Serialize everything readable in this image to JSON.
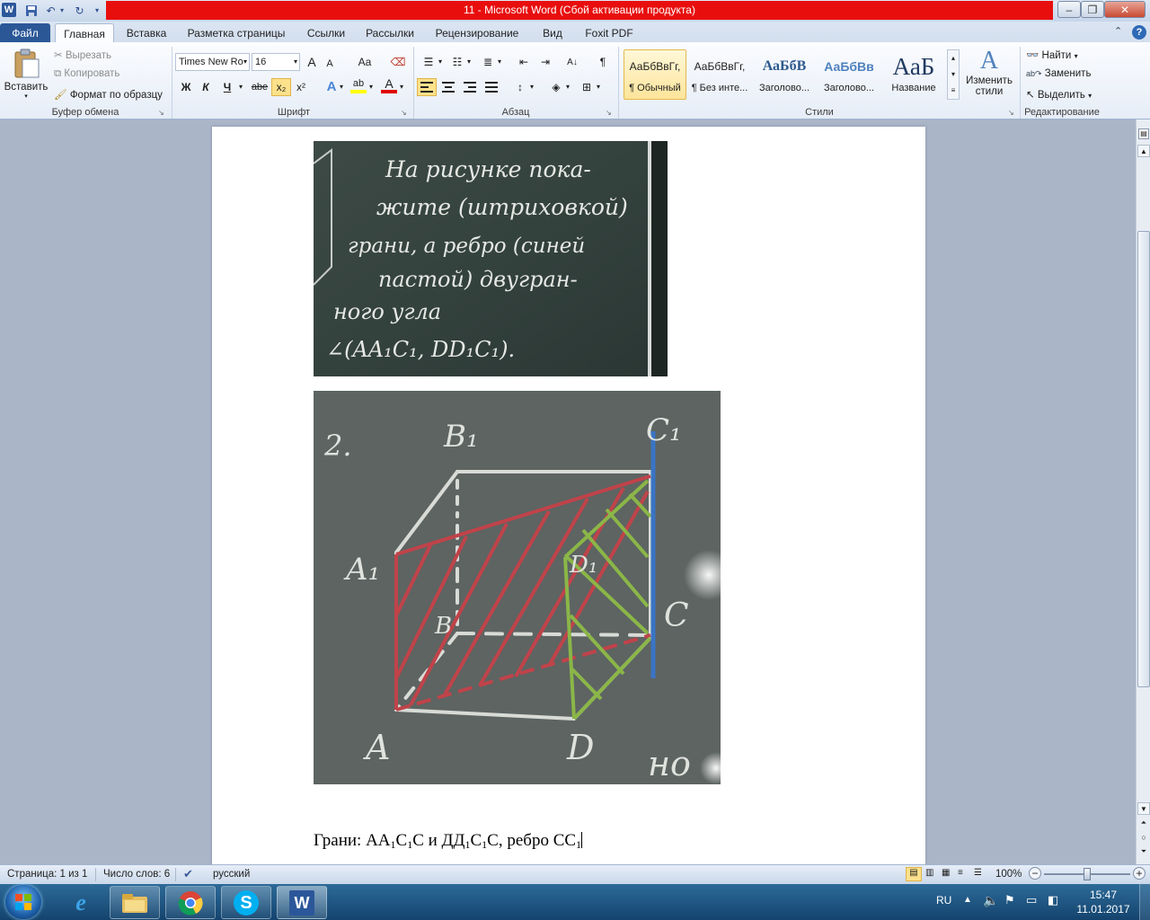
{
  "window": {
    "title": "11  -  Microsoft Word (Сбой активации продукта)",
    "app_icon": "W"
  },
  "tabs": [
    {
      "label": "Файл"
    },
    {
      "label": "Главная"
    },
    {
      "label": "Вставка"
    },
    {
      "label": "Разметка страницы"
    },
    {
      "label": "Ссылки"
    },
    {
      "label": "Рассылки"
    },
    {
      "label": "Рецензирование"
    },
    {
      "label": "Вид"
    },
    {
      "label": "Foxit PDF"
    }
  ],
  "clipboard": {
    "paste": "Вставить",
    "cut": "Вырезать",
    "copy": "Копировать",
    "format_painter": "Формат по образцу",
    "group": "Буфер обмена"
  },
  "font": {
    "name": "Times New Ro",
    "size": "16",
    "group": "Шрифт",
    "bold": "Ж",
    "italic": "К",
    "underline": "Ч",
    "strike": "abe",
    "subscript": "x₂",
    "superscript": "x²",
    "grow": "A",
    "shrink": "A",
    "change_case": "Aa",
    "font_color_letter": "A",
    "highlight_letter": "ab"
  },
  "paragraph": {
    "group": "Абзац"
  },
  "styles": {
    "group": "Стили",
    "items": [
      {
        "preview": "АаБбВвГг,",
        "name": "¶ Обычный"
      },
      {
        "preview": "АаБбВвГг,",
        "name": "¶ Без инте..."
      },
      {
        "preview": "АаБбВ",
        "name": "Заголово..."
      },
      {
        "preview": "АаБбВв",
        "name": "Заголово..."
      },
      {
        "preview": "АаБ",
        "name": "Название"
      }
    ],
    "change_styles": "Изменить стили"
  },
  "editing": {
    "group": "Редактирование",
    "find": "Найти",
    "replace": "Заменить",
    "select": "Выделить"
  },
  "document": {
    "image1_alt": "Доска с заданием",
    "image1_lines": [
      "На рисунке пока-",
      "жите (штриховкой)",
      "грани, а ребро (синей",
      "пастой) двугран-",
      "ного угла",
      "∠(AA₁C₁, DD₁C₁)."
    ],
    "image2_alt": "Чертёж куба с гранями и ребром",
    "image2_labels": [
      "2.",
      "B₁",
      "C₁",
      "A₁",
      "D₁",
      "B",
      "C",
      "A",
      "D",
      "но"
    ],
    "caption_parts": [
      "Грани:  АА",
      "1",
      "С",
      "1",
      "С и ДД",
      "1",
      "С",
      "1",
      "С, ребро СС",
      "1"
    ]
  },
  "statusbar": {
    "page": "Страница: 1 из 1",
    "words": "Число слов: 6",
    "language": "русский",
    "zoom": "100%"
  },
  "taskbar": {
    "lang": "RU",
    "time": "15:47",
    "date": "11.01.2017"
  }
}
